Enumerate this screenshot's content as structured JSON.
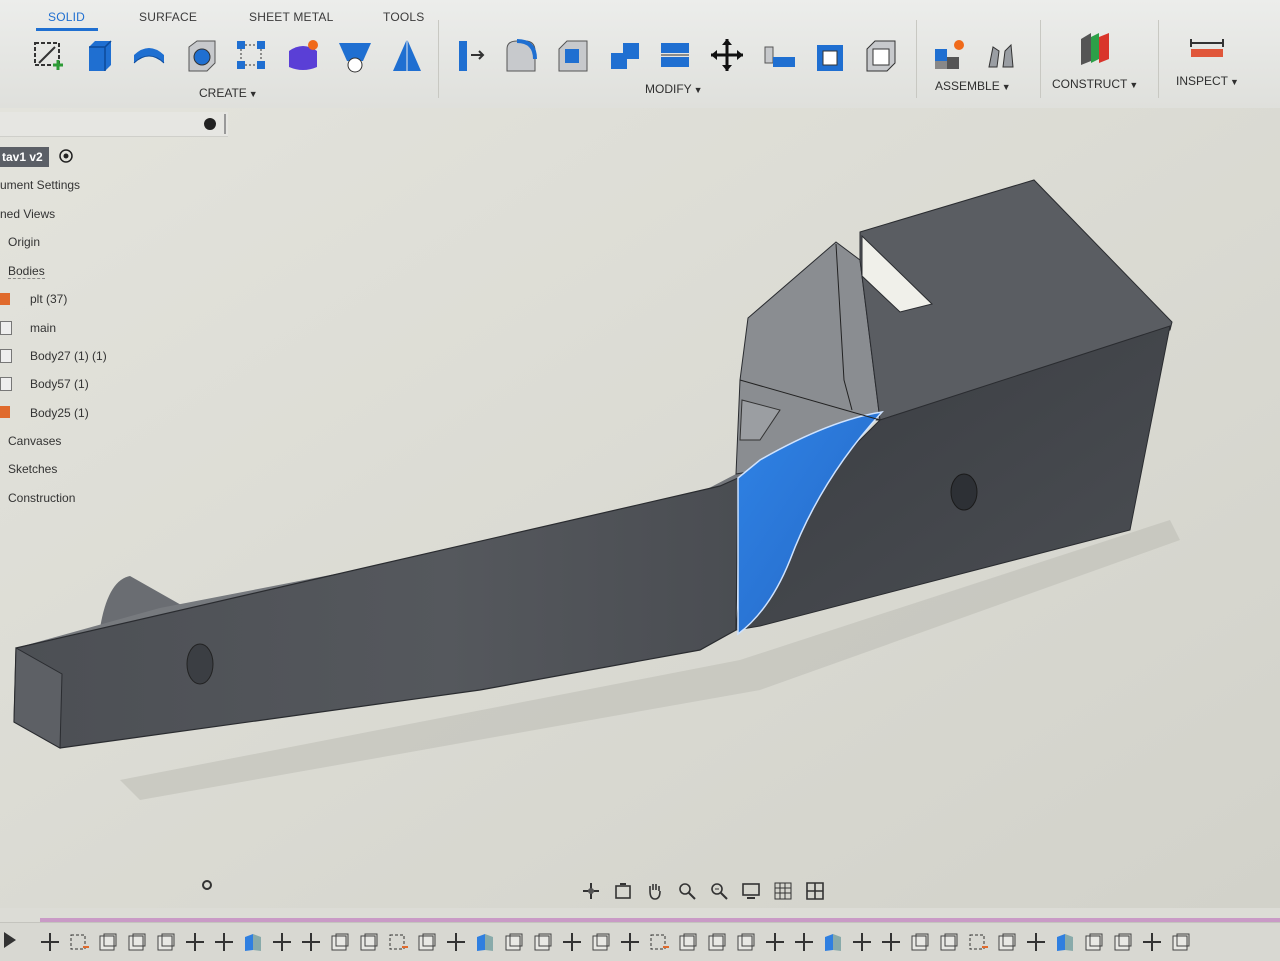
{
  "toolbar": {
    "tabs": [
      {
        "label": "SOLID",
        "active": true
      },
      {
        "label": "SURFACE",
        "active": false
      },
      {
        "label": "SHEET METAL",
        "active": false
      },
      {
        "label": "TOOLS",
        "active": false
      }
    ],
    "groups": {
      "create": "CREATE",
      "modify": "MODIFY",
      "assemble": "ASSEMBLE",
      "construct": "CONSTRUCT",
      "inspect": "INSPECT"
    },
    "create_tools": [
      "create-sketch-icon",
      "extrude-icon",
      "revolve-icon",
      "hole-icon",
      "pattern-icon",
      "create-form-icon",
      "sweep-icon",
      "loft-icon"
    ],
    "modify_tools": [
      "press-pull-icon",
      "fillet-icon",
      "chamfer-icon",
      "shell-icon",
      "combine-icon",
      "split-face-icon",
      "move-icon",
      "align-icon",
      "scale-icon",
      "replace-face-icon"
    ],
    "assemble_tools": [
      "new-component-icon",
      "joint-icon"
    ],
    "construct_tools": [
      "offset-plane-icon"
    ],
    "inspect_tools": [
      "measure-icon"
    ]
  },
  "browser": {
    "document": "tav1 v2",
    "items": [
      {
        "label": "ument Settings",
        "icon": "gear-icon"
      },
      {
        "label": "ned Views",
        "icon": "folder-icon"
      },
      {
        "label": "Origin",
        "icon": "origin-icon"
      },
      {
        "label": "Bodies",
        "icon": "folder-icon"
      },
      {
        "label": "plt (37)",
        "icon": "component-icon"
      },
      {
        "label": "main",
        "icon": "body-icon"
      },
      {
        "label": "Body27 (1) (1)",
        "icon": "body-icon"
      },
      {
        "label": "Body57 (1)",
        "icon": "body-icon"
      },
      {
        "label": "Body25 (1)",
        "icon": "component-icon"
      },
      {
        "label": "Canvases",
        "icon": "folder-icon"
      },
      {
        "label": "Sketches",
        "icon": "folder-icon"
      },
      {
        "label": "Construction",
        "icon": "folder-icon"
      }
    ]
  },
  "navbar": {
    "tools": [
      "orbit-icon",
      "look-at-icon",
      "pan-icon",
      "zoom-icon",
      "fit-icon",
      "display-settings-icon",
      "grid-icon",
      "viewports-icon"
    ]
  },
  "timeline": {
    "play_icon": "play-icon"
  },
  "colors": {
    "accent": "#1f6fd1",
    "body": "#55585d",
    "selected_face": "#2f7fe0",
    "background": "#dcdcd6"
  }
}
